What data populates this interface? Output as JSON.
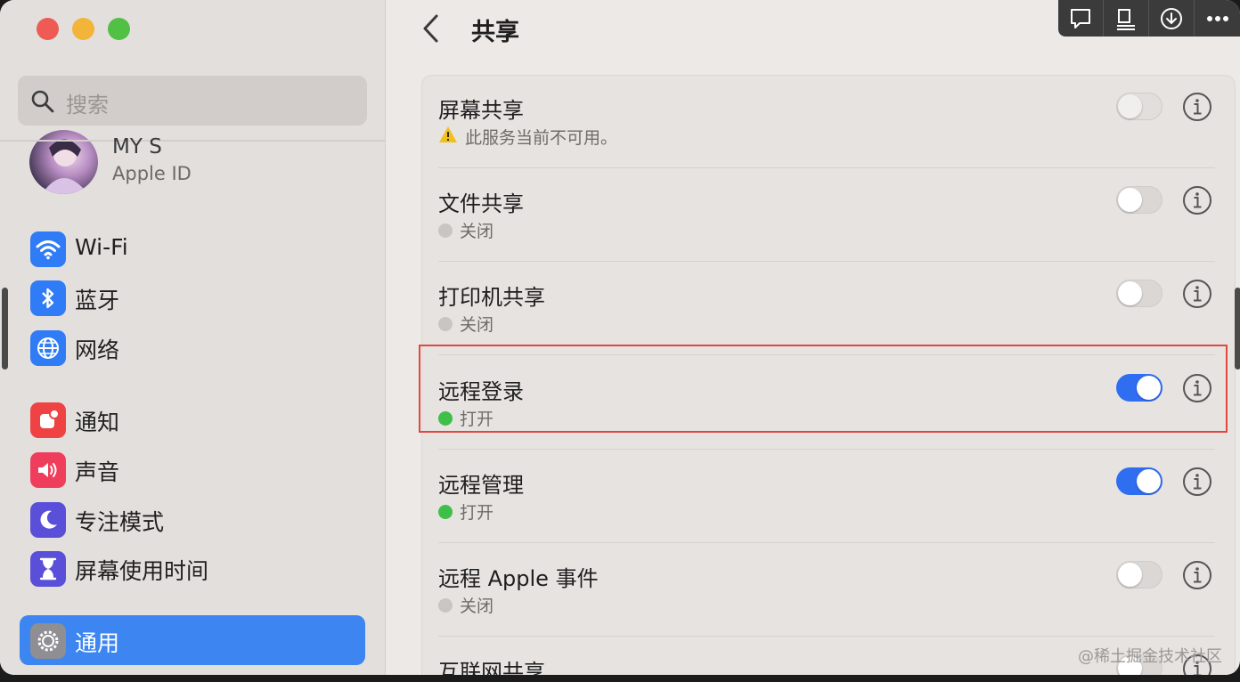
{
  "sidebar": {
    "search_placeholder": "搜索",
    "profile": {
      "name": "MY S",
      "subtitle": "Apple ID"
    },
    "items": [
      {
        "label": "Wi-Fi",
        "icon": "wifi-icon",
        "color": "#2f7cf6"
      },
      {
        "label": "蓝牙",
        "icon": "bluetooth-icon",
        "color": "#2f7cf6"
      },
      {
        "label": "网络",
        "icon": "globe-icon",
        "color": "#2f7cf6"
      },
      {
        "label": "通知",
        "icon": "bell-icon",
        "color": "#ef4343"
      },
      {
        "label": "声音",
        "icon": "speaker-icon",
        "color": "#ef3e5c"
      },
      {
        "label": "专注模式",
        "icon": "moon-icon",
        "color": "#5a4fd8"
      },
      {
        "label": "屏幕使用时间",
        "icon": "hourglass-icon",
        "color": "#5a4fd8"
      },
      {
        "label": "通用",
        "icon": "gear-icon",
        "color": "#8e8e93",
        "active": true
      }
    ]
  },
  "header": {
    "title": "共享",
    "back_icon": "chevron-left-icon"
  },
  "sharing": {
    "rows": [
      {
        "title": "屏幕共享",
        "status": "此服务当前不可用。",
        "status_icon": "warning-icon",
        "enabled": false,
        "disabled": true
      },
      {
        "title": "文件共享",
        "status": "关闭",
        "enabled": false
      },
      {
        "title": "打印机共享",
        "status": "关闭",
        "enabled": false
      },
      {
        "title": "远程登录",
        "status": "打开",
        "enabled": true,
        "highlighted": true
      },
      {
        "title": "远程管理",
        "status": "打开",
        "enabled": true
      },
      {
        "title": "远程 Apple 事件",
        "status": "关闭",
        "enabled": false
      },
      {
        "title": "互联网共享",
        "status": "",
        "enabled": false
      }
    ]
  },
  "toolbar": {
    "icons": [
      "comment-icon",
      "clipboard-icon",
      "download-icon",
      "more-icon"
    ]
  },
  "watermark": "@稀土掘金技术社区",
  "colors": {
    "accent": "#3d86f1",
    "toggle_on": "#2f6ef0",
    "highlight": "#e0483e",
    "status_on": "#3fbf4a"
  }
}
